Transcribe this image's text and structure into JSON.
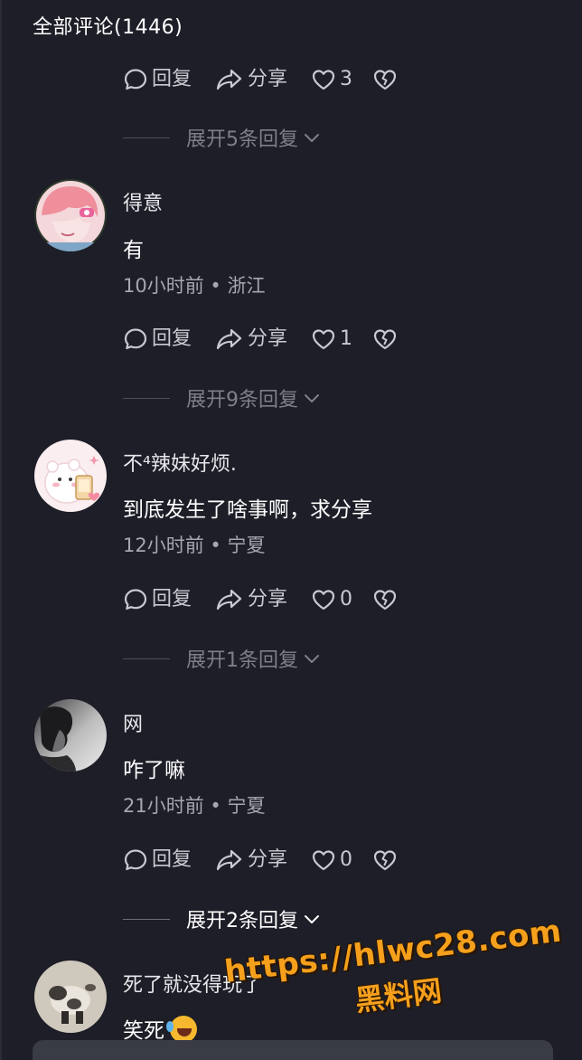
{
  "header": {
    "title": "全部评论(1446)"
  },
  "action_labels": {
    "reply": "回复",
    "share": "分享"
  },
  "top_actions": {
    "likes": "3"
  },
  "top_expand": "展开5条回复",
  "comments": [
    {
      "username": "得意",
      "text": "有",
      "time": "10小时前",
      "location": "浙江",
      "likes": "1",
      "expand": "展开9条回复"
    },
    {
      "username": "不⁴辣妹好烦.",
      "text": "到底发生了啥事啊，求分享",
      "time": "12小时前",
      "location": "宁夏",
      "likes": "0",
      "expand": "展开1条回复"
    },
    {
      "username": "网",
      "text": "咋了嘛",
      "time": "21小时前",
      "location": "宁夏",
      "likes": "0",
      "expand": "展开2条回复"
    },
    {
      "username": "死了就没得玩了",
      "text": "笑死",
      "emoji": "laughing-crying-emoji"
    }
  ],
  "meta_separator": " • ",
  "watermark": {
    "line1": "https://hlwc28.com",
    "line2": "黑料网"
  },
  "icons": {
    "reply": "speech-bubble-icon",
    "share": "share-arrow-icon",
    "like": "heart-icon",
    "dislike": "broken-heart-icon",
    "expand": "chevron-down-icon"
  },
  "colors": {
    "background": "#1d1e27",
    "text_primary": "#ffffff",
    "text_secondary": "#a5a7b1",
    "muted": "#7d7f89",
    "watermark": "#f5a01c"
  }
}
